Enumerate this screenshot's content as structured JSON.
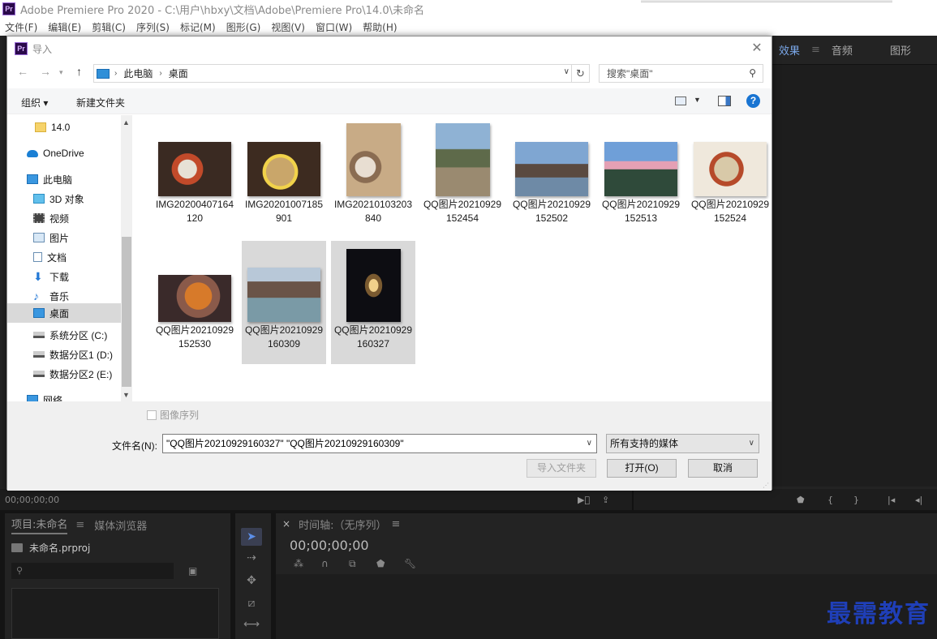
{
  "app": {
    "title": "Adobe Premiere Pro 2020 - C:\\用户\\hbxy\\文档\\Adobe\\Premiere Pro\\14.0\\未命名",
    "logo": "Pr",
    "menu": [
      "文件(F)",
      "编辑(E)",
      "剪辑(C)",
      "序列(S)",
      "标记(M)",
      "图形(G)",
      "视图(V)",
      "窗口(W)",
      "帮助(H)"
    ],
    "right_tabs": {
      "effects": "效果",
      "audio": "音频",
      "graphics": "图形"
    },
    "monitor_timecode": "00;00;00;00",
    "project": {
      "tab": "项目:未命名",
      "media_browser": "媒体浏览器",
      "file": "未命名.prproj"
    },
    "timeline": {
      "title": "时间轴:（无序列）",
      "timecode": "00;00;00;00",
      "close": "×"
    }
  },
  "watermark": "最需教育",
  "dialog": {
    "title": "导入",
    "logo": "Pr",
    "address": [
      "此电脑",
      "桌面"
    ],
    "search_placeholder": "搜索\"桌面\"",
    "organize": "组织 ▾",
    "new_folder": "新建文件夹",
    "help": "?",
    "tree": [
      {
        "label": "14.0",
        "icon": "folder-icon"
      },
      {
        "label": "OneDrive",
        "icon": "cloud-icon"
      },
      {
        "label": "此电脑",
        "icon": "computer-icon"
      },
      {
        "label": "3D 对象",
        "icon": "cube-icon"
      },
      {
        "label": "视频",
        "icon": "video-icon"
      },
      {
        "label": "图片",
        "icon": "picture-icon"
      },
      {
        "label": "文档",
        "icon": "document-icon"
      },
      {
        "label": "下载",
        "icon": "download-icon"
      },
      {
        "label": "音乐",
        "icon": "music-icon"
      },
      {
        "label": "桌面",
        "icon": "desktop-icon"
      },
      {
        "label": "系统分区 (C:)",
        "icon": "drive-c-icon"
      },
      {
        "label": "数据分区1 (D:)",
        "icon": "drive-icon"
      },
      {
        "label": "数据分区2 (E:)",
        "icon": "drive-icon"
      },
      {
        "label": "网络",
        "icon": "network-icon"
      }
    ],
    "files": [
      {
        "name": "IMG20200407164120"
      },
      {
        "name": "IMG20201007185901"
      },
      {
        "name": "IMG20210103203840"
      },
      {
        "name": "QQ图片20210929152454"
      },
      {
        "name": "QQ图片20210929152502"
      },
      {
        "name": "QQ图片20210929152513"
      },
      {
        "name": "QQ图片20210929152524"
      },
      {
        "name": "QQ图片20210929152530"
      },
      {
        "name": "QQ图片20210929160309"
      },
      {
        "name": "QQ图片20210929160327"
      }
    ],
    "image_sequence": "图像序列",
    "filename_label": "文件名(N):",
    "filename_value": "\"QQ图片20210929160327\" \"QQ图片20210929160309\"",
    "filetype": "所有支持的媒体",
    "import_folder": "导入文件夹",
    "open": "打开(O)",
    "cancel": "取消"
  }
}
